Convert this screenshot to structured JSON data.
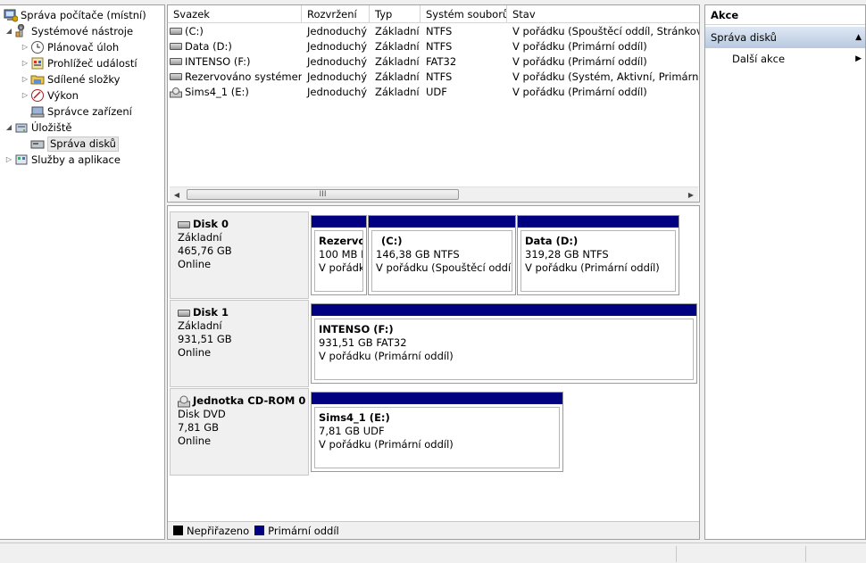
{
  "tree": {
    "items": [
      {
        "label": "Správa počítače (místní)",
        "icon": "computer-management-icon"
      },
      {
        "label": "Systémové nástroje",
        "icon": "tools-icon"
      },
      {
        "label": "Plánovač úloh",
        "icon": "clock-icon"
      },
      {
        "label": "Prohlížeč událostí",
        "icon": "event-viewer-icon"
      },
      {
        "label": "Sdílené složky",
        "icon": "shared-folder-icon"
      },
      {
        "label": "Výkon",
        "icon": "performance-icon"
      },
      {
        "label": "Správce zařízení",
        "icon": "device-manager-icon"
      },
      {
        "label": "Úložiště",
        "icon": "storage-icon"
      },
      {
        "label": "Správa disků",
        "icon": "disk-management-icon"
      },
      {
        "label": "Služby a aplikace",
        "icon": "services-icon"
      }
    ]
  },
  "volumes": {
    "columns": [
      "Svazek",
      "Rozvržení",
      "Typ",
      "Systém souborů",
      "Stav"
    ],
    "rows": [
      {
        "name": "(C:)",
        "layout": "Jednoduchý",
        "type": "Základní",
        "fs": "NTFS",
        "status": "V pořádku (Spouštěcí oddíl, Stránkovací"
      },
      {
        "name": "Data (D:)",
        "layout": "Jednoduchý",
        "type": "Základní",
        "fs": "NTFS",
        "status": "V pořádku (Primární oddíl)"
      },
      {
        "name": "INTENSO (F:)",
        "layout": "Jednoduchý",
        "type": "Základní",
        "fs": "FAT32",
        "status": "V pořádku (Primární oddíl)"
      },
      {
        "name": "Rezervováno systémem",
        "layout": "Jednoduchý",
        "type": "Základní",
        "fs": "NTFS",
        "status": "V pořádku (Systém, Aktivní, Primární od"
      },
      {
        "name": "Sims4_1 (E:)",
        "layout": "Jednoduchý",
        "type": "Základní",
        "fs": "UDF",
        "status": "V pořádku (Primární oddíl)"
      }
    ],
    "scroll_grip": "III"
  },
  "disks": [
    {
      "name": "Disk 0",
      "kind": "Základní",
      "size": "465,76 GB",
      "state": "Online",
      "partitions": [
        {
          "name": "Rezervov",
          "size": "100 MB N",
          "status": "V pořádku"
        },
        {
          "name": "(C:)",
          "size": "146,38 GB NTFS",
          "status": "V pořádku (Spouštěcí oddíl, S"
        },
        {
          "name": "Data  (D:)",
          "size": "319,28 GB NTFS",
          "status": "V pořádku (Primární oddíl)"
        }
      ]
    },
    {
      "name": "Disk 1",
      "kind": "Základní",
      "size": "931,51 GB",
      "state": "Online",
      "partitions": [
        {
          "name": "INTENSO  (F:)",
          "size": "931,51 GB FAT32",
          "status": "V pořádku (Primární oddíl)"
        }
      ]
    },
    {
      "name": "Jednotka CD-ROM 0",
      "kind": "Disk DVD",
      "size": "7,81 GB",
      "state": "Online",
      "partitions": [
        {
          "name": "Sims4_1  (E:)",
          "size": "7,81 GB UDF",
          "status": "V pořádku (Primární oddíl)"
        }
      ]
    }
  ],
  "legend": [
    {
      "label": "Nepřiřazeno",
      "color": "#000000"
    },
    {
      "label": "Primární oddíl",
      "color": "#000080"
    }
  ],
  "actions": {
    "header": "Akce",
    "section": "Správa disků",
    "items": [
      {
        "label": "Další akce"
      }
    ]
  }
}
